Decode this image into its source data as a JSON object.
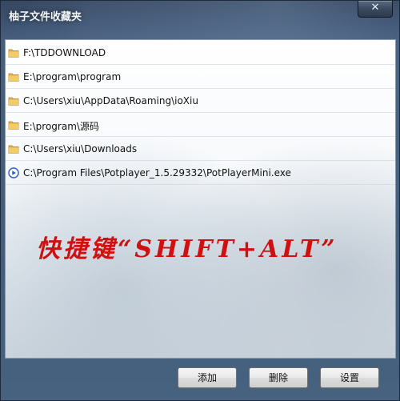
{
  "window": {
    "title": "柚子文件收藏夹",
    "close_label": "✕"
  },
  "favorites": [
    {
      "icon": "folder-icon",
      "path": "F:\\TDDOWNLOAD"
    },
    {
      "icon": "folder-icon",
      "path": "E:\\program\\program"
    },
    {
      "icon": "folder-icon",
      "path": "C:\\Users\\xiu\\AppData\\Roaming\\ioXiu"
    },
    {
      "icon": "folder-icon",
      "path": "E:\\program\\源码"
    },
    {
      "icon": "folder-icon",
      "path": "C:\\Users\\xiu\\Downloads"
    },
    {
      "icon": "potplayer-icon",
      "path": "C:\\Program Files\\Potplayer_1.5.29332\\PotPlayerMini.exe"
    }
  ],
  "shortcut_text": "快捷键“SHIFT+ALT”",
  "buttons": {
    "add": "添加",
    "delete": "删除",
    "settings": "设置"
  },
  "colors": {
    "shortcut": "#d01010",
    "folder": "#e8b84a",
    "player": "#2a5ad8"
  }
}
